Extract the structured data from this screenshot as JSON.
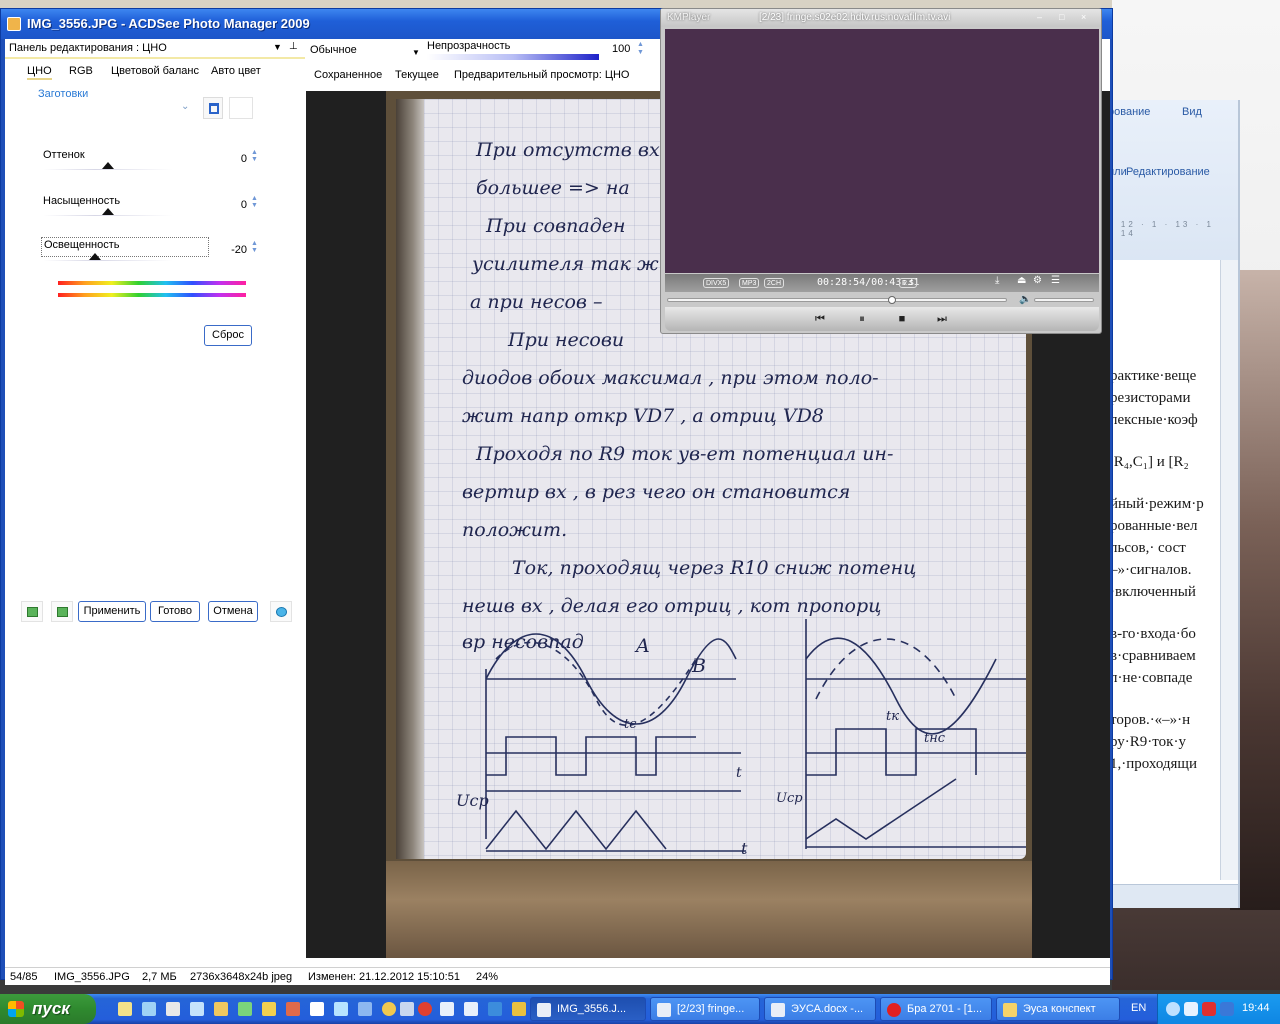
{
  "acdsee": {
    "title": "IMG_3556.JPG - ACDSee Photo Manager 2009",
    "panel": {
      "header": "Панель редактирования : ЦНО",
      "tabs": [
        "ЦНО",
        "RGB",
        "Цветовой баланс",
        "Авто цвет"
      ],
      "presets_label": "Заготовки",
      "sliders": [
        {
          "label": "Оттенок",
          "value": "0",
          "level": 0.5
        },
        {
          "label": "Насыщенность",
          "value": "0",
          "level": 0.5
        },
        {
          "label": "Освещенность",
          "value": "-20",
          "level": 0.4
        }
      ],
      "reset_label": "Сброс",
      "apply_label": "Применить",
      "done_label": "Готово",
      "cancel_label": "Отмена"
    },
    "viewer": {
      "blend_mode": "Обычное",
      "opacity_label": "Непрозрачность",
      "opacity_value": "100",
      "tabs": [
        "Сохраненное",
        "Текущее",
        "Предварительный просмотр: ЦНО"
      ]
    },
    "status": {
      "index": "54/85",
      "filename": "IMG_3556.JPG",
      "filesize": "2,7 МБ",
      "dimensions": "2736x3648x24b jpeg",
      "modified": "Изменен: 21.12.2012 15:10:51",
      "zoom": "24%"
    },
    "photo_text": [
      "При отсутств   вх",
      "большее => на",
      "При совпаден",
      "усилителя так ж",
      "а при несов –",
      "При несови",
      "диодов обоих максимал , при  этом поло-",
      "жит напр откр VD7 , а отриц VD8",
      "Проходя по R9 ток ув-ет потенциал ин-",
      "вертир  вх  , в рез чего  он  становится",
      "положит.",
      "Ток, проходящ через R10 сниж потенц",
      "нешв  вх , делая его отриц , кот пропорц",
      "вр несовпад",
      "A",
      "B",
      "tc",
      "tк",
      "tнс",
      "Uср",
      "Uср",
      "t",
      "t"
    ]
  },
  "kmplayer": {
    "app_name": "KMPlayer",
    "file_title": "[2/23] fringe.s02e02.hdtv.rus.novafilm.tv.avi",
    "badges": [
      "DIVX5",
      "MP3",
      "2CH"
    ],
    "time": "00:28:54/00:43:31",
    "rs_badge": "R S",
    "progress": 0.66
  },
  "word_bg": {
    "tabs": [
      "рование",
      "Вид"
    ],
    "group": "Редактирование",
    "group_left": "или",
    "ruler": "· 12 · 1 · 13 · 1 · 14",
    "lines": [
      "рактике·веще",
      "резисторами",
      "лексные·коэф",
      ",R₄,C₁] и [R₂",
      "йный·режим·р",
      "рованные·вел",
      "льсов,· сост",
      "–»·сигналов.",
      "·включенный",
      "в-го·входа·бо",
      "в·сравниваем",
      "л·не·совпаде",
      "торов.·«–»·н",
      "ру·R9·ток·у",
      "1,·проходящи"
    ]
  },
  "taskbar": {
    "start_label": "пуск",
    "tasks": [
      "IMG_3556.J...",
      "[2/23] fringe...",
      "ЭУСА.docx -...",
      "Бра 2701 - [1...",
      "Эуса конспект"
    ],
    "lang": "EN",
    "clock": "19:44"
  }
}
